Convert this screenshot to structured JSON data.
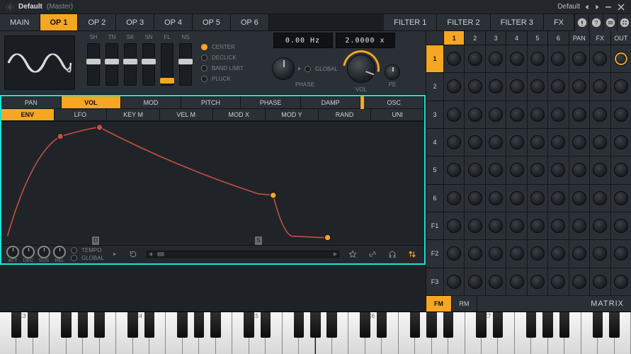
{
  "title": {
    "gear": "gear-icon",
    "name": "Default",
    "context": "(Master)",
    "preset": "Default"
  },
  "main_tabs": [
    "MAIN",
    "OP 1",
    "OP 2",
    "OP 3",
    "OP 4",
    "OP 5",
    "OP 6",
    "FILTER 1",
    "FILTER 2",
    "FILTER 3",
    "FX"
  ],
  "main_tabs_active": 1,
  "osc_sliders": [
    "SH",
    "TN",
    "SK",
    "SN",
    "FL",
    "NS"
  ],
  "osc_slider_pos": [
    50,
    50,
    50,
    50,
    4,
    50
  ],
  "osc_slider_sel": 4,
  "osc_options": [
    "CENTER",
    "DECLICK",
    "BAND LIMIT",
    "PLUCK"
  ],
  "osc_option_sel": 0,
  "readout_freq": "0.00 Hz",
  "readout_ratio": "2.0000 x",
  "phase": {
    "label": "PHASE",
    "global": "GLOBAL"
  },
  "knobs": {
    "vol": "VOL",
    "pe": "PE"
  },
  "param_tabs": [
    "PAN",
    "VOL",
    "MOD",
    "PITCH",
    "PHASE",
    "DAMP",
    "OSC"
  ],
  "param_tabs_active": 1,
  "source_tabs": [
    "ENV",
    "LFO",
    "KEY M",
    "VEL M",
    "MOD X",
    "MOD Y",
    "RAND",
    "UNI"
  ],
  "source_tabs_active": 0,
  "env_knobs": [
    "ATT",
    "DEC",
    "SUS",
    "REL"
  ],
  "env_opts": [
    "TEMPO",
    "GLOBAL"
  ],
  "env_markers": {
    "d": "D",
    "s": "S"
  },
  "matrix": {
    "cols": [
      "1",
      "2",
      "3",
      "4",
      "5",
      "6",
      "PAN",
      "FX",
      "OUT"
    ],
    "rows": [
      "1",
      "2",
      "3",
      "4",
      "5",
      "6",
      "F1",
      "F2",
      "F3"
    ],
    "active_col": 0,
    "active_row": 0,
    "out_active": true,
    "modes": [
      "FM",
      "RM"
    ],
    "mode_active": 0,
    "label": "MATRIX"
  },
  "octaves": [
    "C3",
    "C4",
    "C5",
    "C6",
    "C7"
  ],
  "footer_icons": [
    "snap-icon",
    "link-icon",
    "headphones-icon",
    "swap-icon"
  ]
}
